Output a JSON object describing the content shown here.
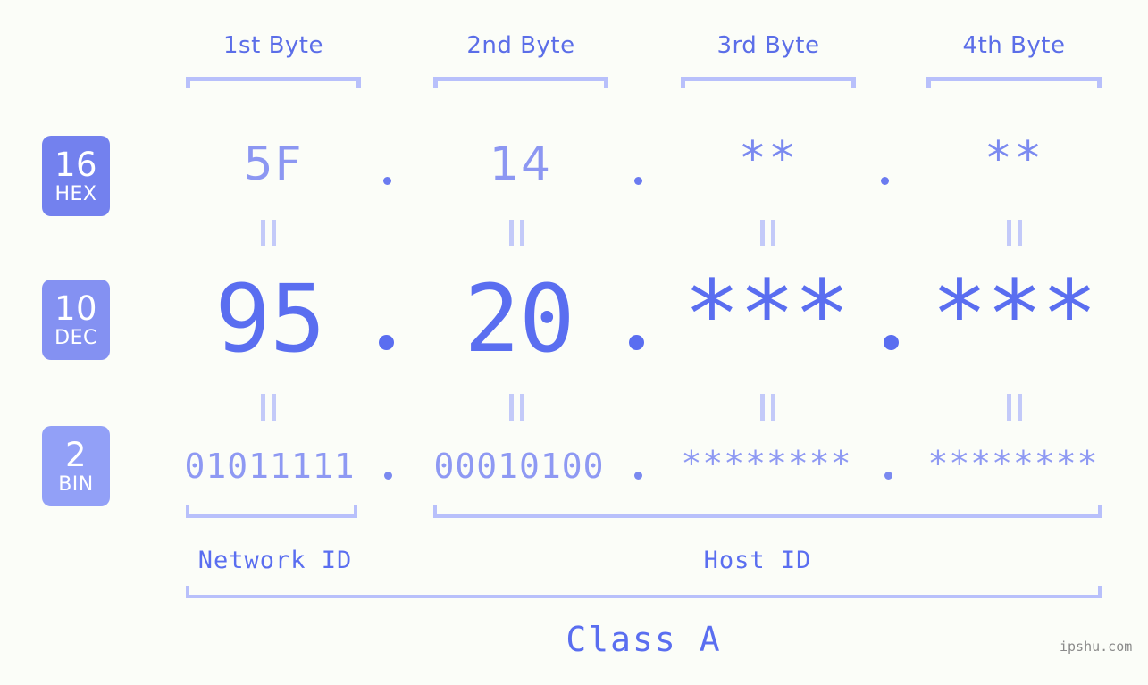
{
  "background_color": "#fbfdf8",
  "accent_color": "#5a6ef0",
  "accent_light": "#8e99f3",
  "bracket_color": "#b8c0fb",
  "header": {
    "bytes": [
      {
        "label": "1st Byte"
      },
      {
        "label": "2nd Byte"
      },
      {
        "label": "3rd Byte"
      },
      {
        "label": "4th Byte"
      }
    ]
  },
  "bases": [
    {
      "num": "16",
      "name": "HEX",
      "color": "#7381ee"
    },
    {
      "num": "10",
      "name": "DEC",
      "color": "#8491f2"
    },
    {
      "num": "2",
      "name": "BIN",
      "color": "#92a0f7"
    }
  ],
  "rows": {
    "hex": {
      "values": [
        "5F",
        "14",
        "**",
        "**"
      ],
      "separator": "."
    },
    "dec": {
      "values": [
        "95",
        "20",
        "***",
        "***"
      ],
      "separator": "."
    },
    "bin": {
      "values": [
        "01011111",
        "00010100",
        "********",
        "********"
      ],
      "separator": "."
    }
  },
  "connectors": {
    "glyph": "||"
  },
  "zones": [
    {
      "label": "Network ID"
    },
    {
      "label": "Host ID"
    }
  ],
  "class": {
    "label": "Class A"
  },
  "watermark": {
    "text": "ipshu.com"
  }
}
